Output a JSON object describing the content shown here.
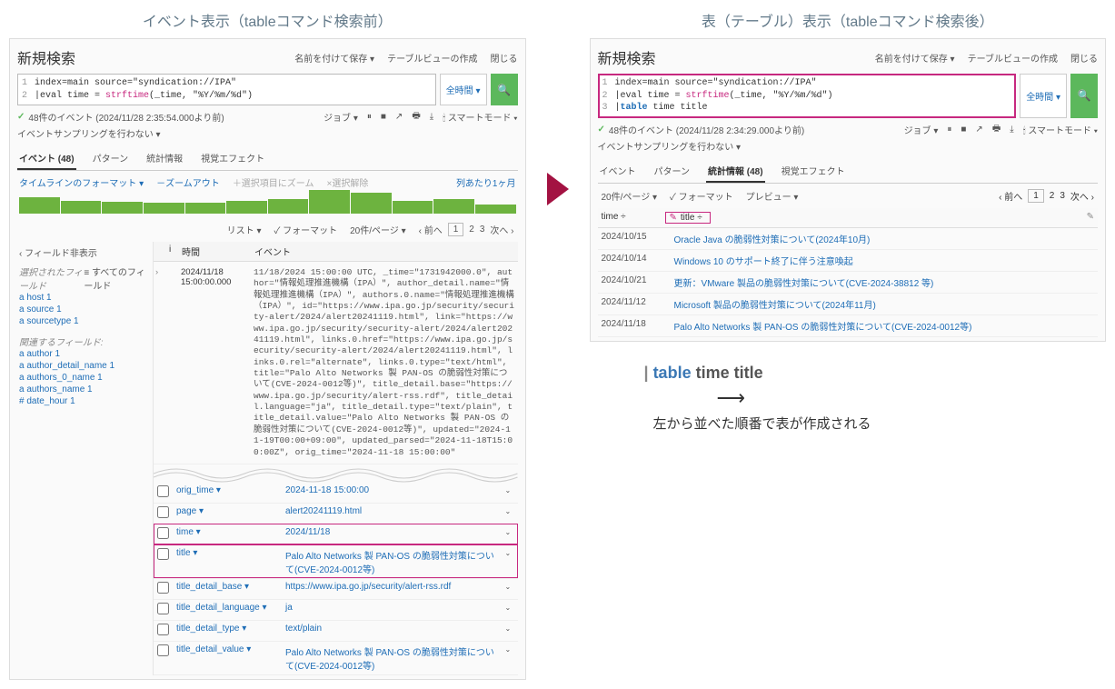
{
  "left": {
    "heading": "イベント表示（tableコマンド検索前）",
    "title": "新規検索",
    "header_links": [
      "名前を付けて保存 ▾",
      "テーブルビューの作成",
      "閉じる"
    ],
    "query_lines": [
      {
        "ln": "1",
        "plain": "index=main source=\"syndication://IPA\""
      },
      {
        "ln": "2",
        "pre": "|eval time = ",
        "func": "strftime",
        "post": "(_time, \"%Y/%m/%d\")"
      }
    ],
    "time_range": "全時間 ▾",
    "status": "48件のイベント (2024/11/28 2:35:54.000より前)",
    "job_label": "ジョブ ▾",
    "smart_mode": "スマートモード ▾",
    "sampling": "イベントサンプリングを行わない ▾",
    "tabs": [
      {
        "label": "イベント",
        "count": "(48)",
        "active": true
      },
      {
        "label": "パターン"
      },
      {
        "label": "統計情報"
      },
      {
        "label": "視覚エフェクト"
      }
    ],
    "tl_fmt": "タイムラインのフォーマット ▾",
    "tl_zoomout": "－ズームアウト",
    "tl_zoomsel": "＋選択項目にズーム",
    "tl_desel": "×選択解除",
    "tl_scale": "列あたり1ヶ月",
    "bars": [
      70,
      55,
      50,
      45,
      48,
      52,
      60,
      100,
      90,
      55,
      60,
      40
    ],
    "list_label": "リスト ▾",
    "format_label": "✓ フォーマット",
    "perpage": "20件/ページ ▾",
    "prev": "‹ 前へ",
    "pages": [
      "1",
      "2",
      "3"
    ],
    "next": "次へ ›",
    "side": {
      "hide": "‹ フィールド非表示",
      "sel": "選択されたフィールド",
      "all": "≡ すべてのフィールド",
      "fields_sel": [
        "a host 1",
        "a source 1",
        "a sourcetype 1"
      ],
      "rel": "関連するフィールド:",
      "fields_rel": [
        "a author 1",
        "a author_detail_name 1",
        "a authors_0_name 1",
        "a authors_name 1",
        "# date_hour 1"
      ]
    },
    "ev_head": {
      "i": "i",
      "time": "時間",
      "event": "イベント"
    },
    "ev": {
      "ts1": "2024/11/18",
      "ts2": "15:00:00.000",
      "body": "11/18/2024 15:00:00 UTC, _time=\"1731942000.0\", author=\"情報処理推進機構（IPA）\", author_detail.name=\"情報処理推進機構（IPA）\", authors.0.name=\"情報処理推進機構（IPA）\", id=\"https://www.ipa.go.jp/security/security-alert/2024/alert20241119.html\", link=\"https://www.ipa.go.jp/security/security-alert/2024/alert20241119.html\", links.0.href=\"https://www.ipa.go.jp/security/security-alert/2024/alert20241119.html\", links.0.rel=\"alternate\", links.0.type=\"text/html\", title=\"Palo Alto Networks 製 PAN-OS の脆弱性対策について(CVE-2024-0012等)\", title_detail.base=\"https://www.ipa.go.jp/security/alert-rss.rdf\", title_detail.language=\"ja\", title_detail.type=\"text/plain\", title_detail.value=\"Palo Alto Networks 製 PAN-OS の脆弱性対策について(CVE-2024-0012等)\", updated=\"2024-11-19T00:00+09:00\", updated_parsed=\"2024-11-18T15:00:00Z\", orig_time=\"2024-11-18 15:00:00\""
    },
    "kv": [
      {
        "k": "orig_time ▾",
        "v": "2024-11-18 15:00:00"
      },
      {
        "k": "page ▾",
        "v": "alert20241119.html"
      },
      {
        "k": "time ▾",
        "v": "2024/11/18",
        "hl": true
      },
      {
        "k": "title ▾",
        "v": "Palo Alto Networks 製 PAN-OS の脆弱性対策について(CVE-2024-0012等)",
        "hl": true
      },
      {
        "k": "title_detail_base ▾",
        "v": "https://www.ipa.go.jp/security/alert-rss.rdf"
      },
      {
        "k": "title_detail_language ▾",
        "v": "ja"
      },
      {
        "k": "title_detail_type ▾",
        "v": "text/plain"
      },
      {
        "k": "title_detail_value ▾",
        "v": "Palo Alto Networks 製 PAN-OS の脆弱性対策について(CVE-2024-0012等)"
      }
    ]
  },
  "right": {
    "heading": "表（テーブル）表示（tableコマンド検索後）",
    "title": "新規検索",
    "header_links": [
      "名前を付けて保存 ▾",
      "テーブルビューの作成",
      "閉じる"
    ],
    "query_lines": [
      {
        "ln": "1",
        "plain": "index=main source=\"syndication://IPA\""
      },
      {
        "ln": "2",
        "pre": "|eval time = ",
        "func": "strftime",
        "post": "(_time, \"%Y/%m/%d\")"
      },
      {
        "ln": "3",
        "pre": "|",
        "cmd": "table",
        "post": " time title"
      }
    ],
    "time_range": "全時間 ▾",
    "status": "48件のイベント (2024/11/28 2:34:29.000より前)",
    "job_label": "ジョブ ▾",
    "smart_mode": "スマートモード ▾",
    "sampling": "イベントサンプリングを行わない ▾",
    "tabs": [
      {
        "label": "イベント"
      },
      {
        "label": "パターン"
      },
      {
        "label": "統計情報",
        "count": "(48)",
        "active": true
      },
      {
        "label": "視覚エフェクト"
      }
    ],
    "perpage": "20件/ページ ▾",
    "format": "✓ フォーマット",
    "preview": "プレビュー ▾",
    "prev": "‹ 前へ",
    "pages": [
      "1",
      "2",
      "3"
    ],
    "next": "次へ ›",
    "cols": {
      "c1": "time ÷",
      "c2": "title ÷"
    },
    "rows": [
      {
        "d": "2024/10/15",
        "t": "Oracle Java の脆弱性対策について(2024年10月)"
      },
      {
        "d": "2024/10/14",
        "t": "Windows 10 のサポート終了に伴う注意喚起"
      },
      {
        "d": "2024/10/21",
        "t": "更新：VMware 製品の脆弱性対策について(CVE-2024-38812 等)"
      },
      {
        "d": "2024/11/12",
        "t": "Microsoft 製品の脆弱性対策について(2024年11月)"
      },
      {
        "d": "2024/11/18",
        "t": "Palo Alto Networks 製 PAN-OS の脆弱性対策について(CVE-2024-0012等)"
      }
    ],
    "annot": {
      "pipe": "|",
      "cmd": "table",
      "rest": " time title",
      "caption": "左から並べた順番で表が作成される"
    }
  }
}
